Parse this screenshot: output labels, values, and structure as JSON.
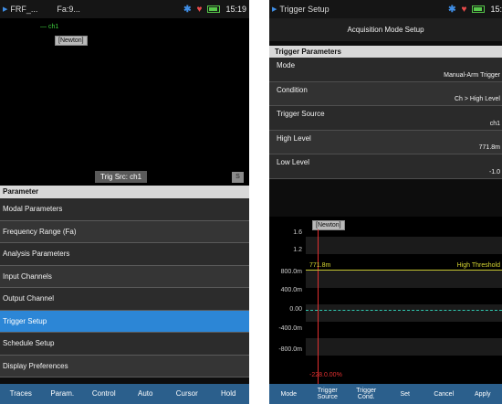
{
  "left": {
    "status": {
      "app": "FRF_...",
      "tab": "Fa:9...",
      "time": "15:19"
    },
    "plot": {
      "legend": "— ch1",
      "newton": "[Newton]",
      "trigger_source": "Trig Src: ch1",
      "s_box": "S"
    },
    "menu": {
      "header": "Parameter",
      "items": [
        {
          "label": "Modal Parameters",
          "active": false
        },
        {
          "label": "Frequency Range (Fa)",
          "active": false
        },
        {
          "label": "Analysis Parameters",
          "active": false
        },
        {
          "label": "Input Channels",
          "active": false
        },
        {
          "label": "Output Channel",
          "active": false
        },
        {
          "label": "Trigger Setup",
          "active": true
        },
        {
          "label": "Schedule Setup",
          "active": false
        },
        {
          "label": "Display Preferences",
          "active": false
        }
      ]
    },
    "buttons": [
      "Traces",
      "Param.",
      "Control",
      "Auto",
      "Cursor",
      "Hold"
    ]
  },
  "right": {
    "status": {
      "app": "Trigger Setup",
      "time": "15:"
    },
    "title": "Acquisition Mode Setup",
    "params_header": "Trigger Parameters",
    "params": [
      {
        "label": "Mode",
        "value": "Manual-Arm Trigger"
      },
      {
        "label": "Condition",
        "value": "Ch > High Level"
      },
      {
        "label": "Trigger Source",
        "value": "ch1"
      },
      {
        "label": "High Level",
        "value": "771.8m"
      },
      {
        "label": "Low Level",
        "value": "-1.0"
      }
    ],
    "plot": {
      "newton": "[Newton]",
      "yticks": [
        "1.6",
        "1.2",
        "800.0m",
        "400.0m",
        "0.00",
        "-400.0m",
        "-800.0m"
      ],
      "high_value": "771.8m",
      "high_label": "High Threshold",
      "red_label": "-228.0.00%"
    },
    "buttons": [
      {
        "l1": "Mode",
        "l2": ""
      },
      {
        "l1": "Trigger",
        "l2": "Source"
      },
      {
        "l1": "Trigger",
        "l2": "Cond."
      },
      {
        "l1": "Set",
        "l2": ""
      },
      {
        "l1": "Cancel",
        "l2": ""
      },
      {
        "l1": "Apply",
        "l2": ""
      }
    ]
  },
  "colors": {
    "accent": "#2c86d6",
    "bottom_bar": "#2b5f8c",
    "high_threshold": "#c8c832",
    "trigger_line": "#e23030",
    "trace": "#2fc8b0",
    "legend": "#3ecf3e"
  }
}
